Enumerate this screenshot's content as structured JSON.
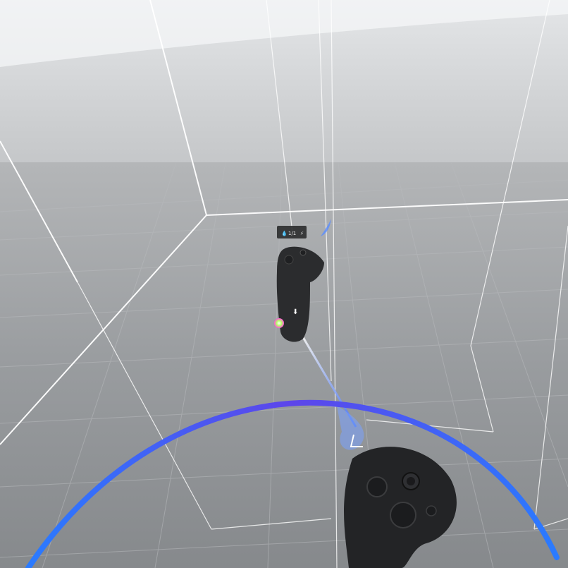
{
  "scene": {
    "type": "vr-environment",
    "colors": {
      "sky_top": "#f2f3f4",
      "floor": "#8c8f92",
      "boundary_lines": "#ffffff",
      "guardian_arc": "#3a6cff",
      "guardian_arc_alt": "#6a4cf0",
      "controller_body": "#2b2c2e",
      "pointer_ray": "#5a8cff"
    }
  },
  "left_controller": {
    "icon": "left-vr-controller-icon",
    "hud": {
      "label": "1/1",
      "left_icon": "droplet-icon",
      "right_icon": "lightning-icon"
    },
    "trigger_hint_icon": "down-arrow-icon",
    "color_wheel_icon": "color-wheel-icon"
  },
  "right_controller": {
    "icon": "right-vr-controller-icon"
  },
  "guardian": {
    "label": "",
    "shape": "arc"
  }
}
